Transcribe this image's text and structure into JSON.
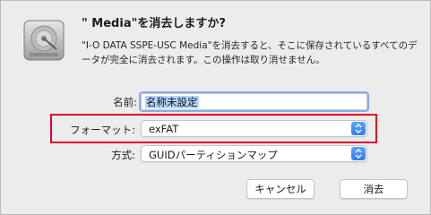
{
  "dialog": {
    "title": "\" Media\"を消去しますか?",
    "message": "\"I-O DATA SSPE-USC Media\"を消去すると、そこに保存されているすべてのデータが完全に消去されます。この操作は取り消せません。"
  },
  "fields": {
    "name_label": "名前:",
    "name_value": "名称未設定",
    "format_label": "フォーマット:",
    "format_value": "exFAT",
    "scheme_label": "方式:",
    "scheme_value": "GUIDパーティションマップ"
  },
  "buttons": {
    "cancel": "キャンセル",
    "erase": "消去"
  },
  "colors": {
    "highlight": "#e0002b",
    "accent": "#2f7ff0"
  },
  "icons": {
    "disk": "disk-icon",
    "stepper": "chevron-updown-icon"
  }
}
